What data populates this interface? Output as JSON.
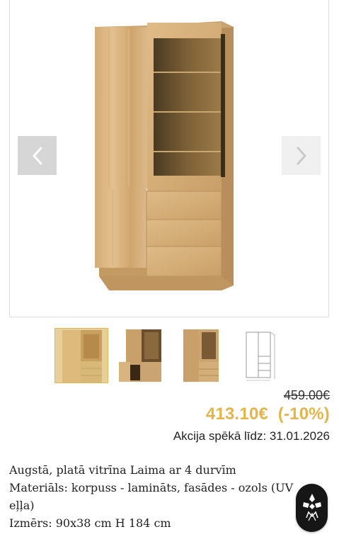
{
  "gallery": {
    "prev_icon": "chevron-left-icon",
    "next_icon": "chevron-right-icon",
    "thumbnails": [
      {
        "name": "front-view",
        "active": true
      },
      {
        "name": "open-doors-view",
        "active": false
      },
      {
        "name": "angled-view",
        "active": false
      },
      {
        "name": "sketch-drawing",
        "active": false
      }
    ]
  },
  "price": {
    "old": "459.00€",
    "new": "413.10€  (-10%)",
    "promo": "Akcija spēkā līdz: 31.01.2026"
  },
  "description": {
    "line1": "Augstā, platā vitrīna Laima ar 4 durvīm",
    "line2": "Materiāls: korpuss - lamināts, fasādes - ozols (UV",
    "line3": "eļļa)",
    "line4": "Izmērs: 90x38 cm H 184 cm"
  },
  "colors": {
    "accent": "#e3b54b",
    "wood": "#d9b583",
    "fab": "#161616"
  },
  "fab": {
    "icon": "brand-logo-icon"
  }
}
